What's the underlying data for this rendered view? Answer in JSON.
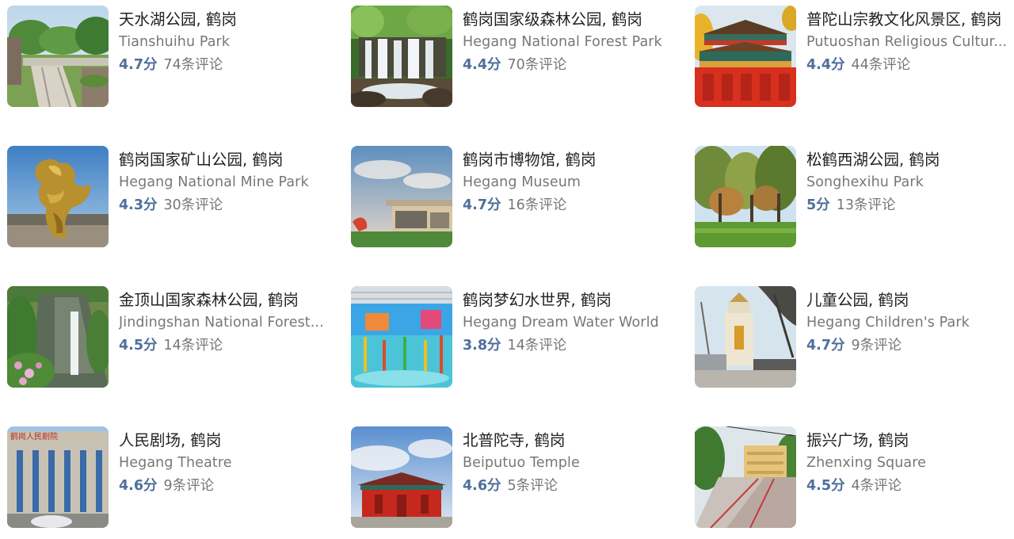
{
  "places": [
    {
      "name_cn": "天水湖公园, 鹤岗",
      "name_en": "Tianshuihu Park",
      "score": "4.7分",
      "reviews": "74条评论",
      "image": "park-bridge-photo"
    },
    {
      "name_cn": "鹤岗国家级森林公园, 鹤岗",
      "name_en": "Hegang National Forest Park",
      "score": "4.4分",
      "reviews": "70条评论",
      "image": "forest-waterfall-photo"
    },
    {
      "name_cn": "普陀山宗教文化风景区, 鹤岗",
      "name_en": "Putuoshan Religious Cultur...",
      "score": "4.4分",
      "reviews": "44条评论",
      "image": "temple-facade-photo"
    },
    {
      "name_cn": "鹤岗国家矿山公园, 鹤岗",
      "name_en": "Hegang National Mine Park",
      "score": "4.3分",
      "reviews": "30条评论",
      "image": "golden-statue-photo"
    },
    {
      "name_cn": "鹤岗市博物馆, 鹤岗",
      "name_en": "Hegang Museum",
      "score": "4.7分",
      "reviews": "16条评论",
      "image": "museum-building-photo"
    },
    {
      "name_cn": "松鹤西湖公园, 鹤岗",
      "name_en": "Songhexihu Park",
      "score": "5分",
      "reviews": "13条评论",
      "image": "autumn-trees-photo"
    },
    {
      "name_cn": "金顶山国家森林公园, 鹤岗",
      "name_en": "Jindingshan National Forest...",
      "score": "4.5分",
      "reviews": "14条评论",
      "image": "mountain-waterfall-photo"
    },
    {
      "name_cn": "鹤岗梦幻水世界, 鹤岗",
      "name_en": "Hegang Dream Water World",
      "score": "3.8分",
      "reviews": "14条评论",
      "image": "water-park-photo"
    },
    {
      "name_cn": "儿童公园, 鹤岗",
      "name_en": "Hegang Children's Park",
      "score": "4.7分",
      "reviews": "9条评论",
      "image": "park-gate-tower-photo"
    },
    {
      "name_cn": "人民剧场, 鹤岗",
      "name_en": "Hegang Theatre",
      "score": "4.6分",
      "reviews": "9条评论",
      "image": "theatre-building-photo",
      "image_sign": "鹤岗人民剧院"
    },
    {
      "name_cn": "北普陀寺, 鹤岗",
      "name_en": "Beiputuo Temple",
      "score": "4.6分",
      "reviews": "5条评论",
      "image": "red-temple-photo"
    },
    {
      "name_cn": "振兴广场, 鹤岗",
      "name_en": "Zhenxing Square",
      "score": "4.5分",
      "reviews": "4条评论",
      "image": "wet-square-photo"
    }
  ],
  "colors": {
    "score": "#4f6f9b",
    "title": "#222222",
    "subtitle": "#777777"
  }
}
